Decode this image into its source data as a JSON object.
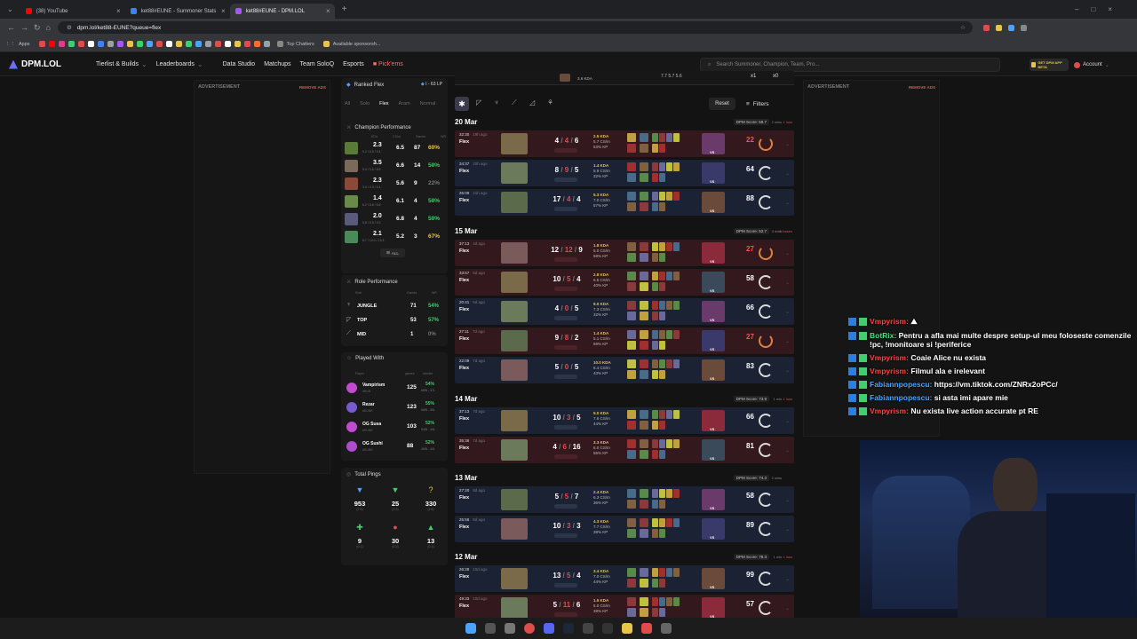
{
  "browser": {
    "tabs": [
      {
        "label": "(38) YouTube",
        "color": "#ff0000"
      },
      {
        "label": "ket88#EUNE - Summoner Stats",
        "color": "#3b82f6"
      },
      {
        "label": "ket88#EUNE - DPM.LOL",
        "color": "#a855f7"
      }
    ],
    "url": "dpm.lol/ket88-EUNE?queue=flex",
    "bookmarks": {
      "apps": "Apps",
      "top_chatters": "Top Chatters",
      "available": "Available sponsorsh..."
    }
  },
  "site": {
    "logo": "DPM.LOL",
    "nav": [
      "Tierlist & Builds",
      "Leaderboards",
      "Data Studio",
      "Matchups",
      "Team SoloQ",
      "Esports",
      "Pick'ems"
    ],
    "search_placeholder": "Search Summoner, Champion, Team, Pro...",
    "app_badge": "GET DPM APP BETA",
    "account": "Account"
  },
  "ads": {
    "label": "ADVERTISEMENT",
    "remove": "REMOVE ADS"
  },
  "ranked": {
    "queue": "Ranked Flex",
    "rank": "I - 63 LP",
    "filters": [
      "All",
      "Solo",
      "Flex",
      "Aram",
      "Normal"
    ],
    "active_filter": "Flex"
  },
  "champion_performance": {
    "title": "Champion Performance",
    "headers": [
      "KDA",
      "CS/m",
      "Games",
      "WR"
    ],
    "rows": [
      {
        "kda": "2.3",
        "kda_detail": "9.2 / 6.5 / 5.4",
        "cs": "6.5",
        "games": "87",
        "wr": "60%",
        "color": "#5a7a3a"
      },
      {
        "kda": "3.5",
        "kda_detail": "5.4 / 3.6 / 8.5",
        "cs": "6.6",
        "games": "14",
        "wr": "50%",
        "color": "#7a6a5a"
      },
      {
        "kda": "2.3",
        "kda_detail": "3.4 / 4.3 / 6.4",
        "cs": "5.6",
        "games": "9",
        "wr": "22%",
        "color": "#8a4a3a"
      },
      {
        "kda": "1.4",
        "kda_detail": "6.2 / 8.8 / 5.8",
        "cs": "6.1",
        "games": "4",
        "wr": "50%",
        "color": "#6a8a4a"
      },
      {
        "kda": "2.0",
        "kda_detail": "5.8 / 5.5 / 5.3",
        "cs": "6.8",
        "games": "4",
        "wr": "50%",
        "color": "#5a5a7a"
      },
      {
        "kda": "2.1",
        "kda_detail": "8.7 / 10.0 / 13.3",
        "cs": "5.2",
        "games": "3",
        "wr": "67%",
        "color": "#4a8a5a"
      }
    ],
    "all_label": "ALL"
  },
  "role_performance": {
    "title": "Role Performance",
    "headers": [
      "Role",
      "Games",
      "WR"
    ],
    "rows": [
      {
        "role": "JUNGLE",
        "games": "71",
        "wr": "54%"
      },
      {
        "role": "TOP",
        "games": "53",
        "wr": "57%"
      },
      {
        "role": "MID",
        "games": "1",
        "wr": "0%"
      }
    ]
  },
  "played_with": {
    "title": "Played With",
    "headers": [
      "Player",
      "games",
      "winrate"
    ],
    "rows": [
      {
        "name": "Vampirism",
        "tag": "#EUN",
        "games": "125",
        "wr": "54%",
        "rec": "68W - 57L",
        "color": "#c04ad0"
      },
      {
        "name": "Rezar",
        "tag": "#EUNE",
        "games": "123",
        "wr": "55%",
        "rec": "68W - 55L",
        "color": "#7a5ad0"
      },
      {
        "name": "OG Susa",
        "tag": "#EUNE",
        "games": "103",
        "wr": "52%",
        "rec": "54W - 49L",
        "color": "#c04ad0"
      },
      {
        "name": "OG Sushi",
        "tag": "#EUNE",
        "games": "88",
        "wr": "52%",
        "rec": "46W - 42L",
        "color": "#b04ad0"
      }
    ]
  },
  "total_pings": {
    "title": "Total Pings",
    "values": [
      {
        "value": "953",
        "avg": "(7.6)",
        "color": "#4aa3ff",
        "glyph": "▼"
      },
      {
        "value": "25",
        "avg": "(0.2)",
        "color": "#3ecf6e",
        "glyph": "▼"
      },
      {
        "value": "330",
        "avg": "(2.6)",
        "color": "#e8c547",
        "glyph": "?"
      },
      {
        "value": "9",
        "avg": "(0.1)",
        "color": "#3ecf6e",
        "glyph": "✚"
      },
      {
        "value": "30",
        "avg": "(0.2)",
        "color": "#e04b4b",
        "glyph": "●"
      },
      {
        "value": "13",
        "avg": "(0.1)",
        "color": "#3ecf6e",
        "glyph": "▲"
      }
    ]
  },
  "toolbar": {
    "reset": "Reset",
    "filters": "Filters"
  },
  "top_partial": {
    "kda": "3.6 KDA",
    "kda_nums": "7.7  5.7  5.6",
    "x1": "x1",
    "x0": "x0"
  },
  "matches": {
    "dates": [
      {
        "date": "20 Mar",
        "score": "DPM Score: 58.7",
        "wins": "2 wins",
        "losses": "1 loss"
      },
      {
        "date": "15 Mar",
        "score": "DPM Score: 52.7",
        "wins": "3 wins",
        "losses": "2 losses"
      },
      {
        "date": "14 Mar",
        "score": "DPM Score: 73.9",
        "wins": "1 win",
        "losses": "1 loss"
      },
      {
        "date": "13 Mar",
        "score": "DPM Score: 74.3",
        "wins": "2 wins",
        "losses": ""
      },
      {
        "date": "12 Mar",
        "score": "DPM Score: 78.3",
        "wins": "1 win",
        "losses": "1 loss"
      }
    ],
    "rows": [
      {
        "time": "32:30",
        "ago": "19h ago",
        "queue": "Flex",
        "k": "4",
        "d": "4",
        "a": "6",
        "kda_r": "2.5 KDA",
        "cs": "5.7 CS/m",
        "kp": "53% KP",
        "grade": "22",
        "result": "loss"
      },
      {
        "time": "34:37",
        "ago": "20h ago",
        "queue": "Flex",
        "k": "8",
        "d": "9",
        "a": "5",
        "kda_r": "1.4 KDA",
        "cs": "5.9 CS/m",
        "kp": "32% KP",
        "grade": "64",
        "result": "win"
      },
      {
        "time": "26:09",
        "ago": "21h ago",
        "queue": "Flex",
        "k": "17",
        "d": "4",
        "a": "4",
        "kda_r": "5.3 KDA",
        "cs": "7.0 CS/m",
        "kp": "57% KP",
        "grade": "88",
        "result": "win"
      },
      {
        "time": "37:13",
        "ago": "4d ago",
        "queue": "Flex",
        "k": "12",
        "d": "12",
        "a": "9",
        "kda_r": "1.8 KDA",
        "cs": "5.0 CS/m",
        "kp": "58% KP",
        "grade": "27",
        "result": "loss"
      },
      {
        "time": "33:57",
        "ago": "6d ago",
        "queue": "Flex",
        "k": "10",
        "d": "5",
        "a": "4",
        "kda_r": "2.8 KDA",
        "cs": "6.5 CS/m",
        "kp": "40% KP",
        "grade": "58",
        "result": "loss"
      },
      {
        "time": "20:41",
        "ago": "6d ago",
        "queue": "Flex",
        "k": "4",
        "d": "0",
        "a": "5",
        "kda_r": "9.0 KDA",
        "cs": "7.3 CS/m",
        "kp": "32% KP",
        "grade": "66",
        "result": "win"
      },
      {
        "time": "27:11",
        "ago": "7d ago",
        "queue": "Flex",
        "k": "9",
        "d": "8",
        "a": "2",
        "kda_r": "1.4 KDA",
        "cs": "5.1 CS/m",
        "kp": "69% KP",
        "grade": "27",
        "result": "loss"
      },
      {
        "time": "22:09",
        "ago": "7d ago",
        "queue": "Flex",
        "k": "5",
        "d": "0",
        "a": "5",
        "kda_r": "10.0 KDA",
        "cs": "6.4 CS/m",
        "kp": "43% KP",
        "grade": "83",
        "result": "win"
      },
      {
        "time": "37:13",
        "ago": "7d ago",
        "queue": "Flex",
        "k": "10",
        "d": "3",
        "a": "5",
        "kda_r": "5.0 KDA",
        "cs": "7.6 CS/m",
        "kp": "44% KP",
        "grade": "66",
        "result": "win"
      },
      {
        "time": "35:36",
        "ago": "7d ago",
        "queue": "Flex",
        "k": "4",
        "d": "6",
        "a": "16",
        "kda_r": "3.3 KDA",
        "cs": "6.0 CS/m",
        "kp": "55% KP",
        "grade": "81",
        "result": "loss"
      },
      {
        "time": "27:20",
        "ago": "8d ago",
        "queue": "Flex",
        "k": "5",
        "d": "5",
        "a": "7",
        "kda_r": "2.4 KDA",
        "cs": "6.3 CS/m",
        "kp": "36% KP",
        "grade": "58",
        "result": "win"
      },
      {
        "time": "25:58",
        "ago": "8d ago",
        "queue": "Flex",
        "k": "10",
        "d": "3",
        "a": "3",
        "kda_r": "4.3 KDA",
        "cs": "7.7 CS/m",
        "kp": "38% KP",
        "grade": "89",
        "result": "win"
      },
      {
        "time": "26:28",
        "ago": "10d ago",
        "queue": "Flex",
        "k": "13",
        "d": "5",
        "a": "4",
        "kda_r": "3.4 KDA",
        "cs": "7.0 CS/m",
        "kp": "44% KP",
        "grade": "99",
        "result": "win"
      },
      {
        "time": "49:33",
        "ago": "10d ago",
        "queue": "Flex",
        "k": "5",
        "d": "11",
        "a": "6",
        "kda_r": "1.5 KDA",
        "cs": "5.0 CS/m",
        "kp": "38% KP",
        "grade": "57",
        "result": "loss"
      }
    ]
  },
  "chat": [
    {
      "user": "Vmpyrism:",
      "msg": "⛰",
      "ucolor": "#ff4040"
    },
    {
      "user": "BotRix:",
      "msg": "Pentru a afla mai multe despre setup-ul meu foloseste comenzile !pc, !monitoare si !periferice",
      "ucolor": "#4ade80"
    },
    {
      "user": "Vmpyrism:",
      "msg": "Coaie Alice nu exista",
      "ucolor": "#ff4040"
    },
    {
      "user": "Vmpyrism:",
      "msg": "Filmul ala e irelevant",
      "ucolor": "#ff4040"
    },
    {
      "user": "Fabiannpopescu:",
      "msg": "https://vm.tiktok.com/ZNRx2oPCc/",
      "ucolor": "#4aa3ff"
    },
    {
      "user": "Fabiannpopescu:",
      "msg": "si asta imi apare mie",
      "ucolor": "#4aa3ff"
    },
    {
      "user": "Vmpyrism:",
      "msg": "Nu exista live action accurate pt RE",
      "ucolor": "#ff4040"
    }
  ]
}
